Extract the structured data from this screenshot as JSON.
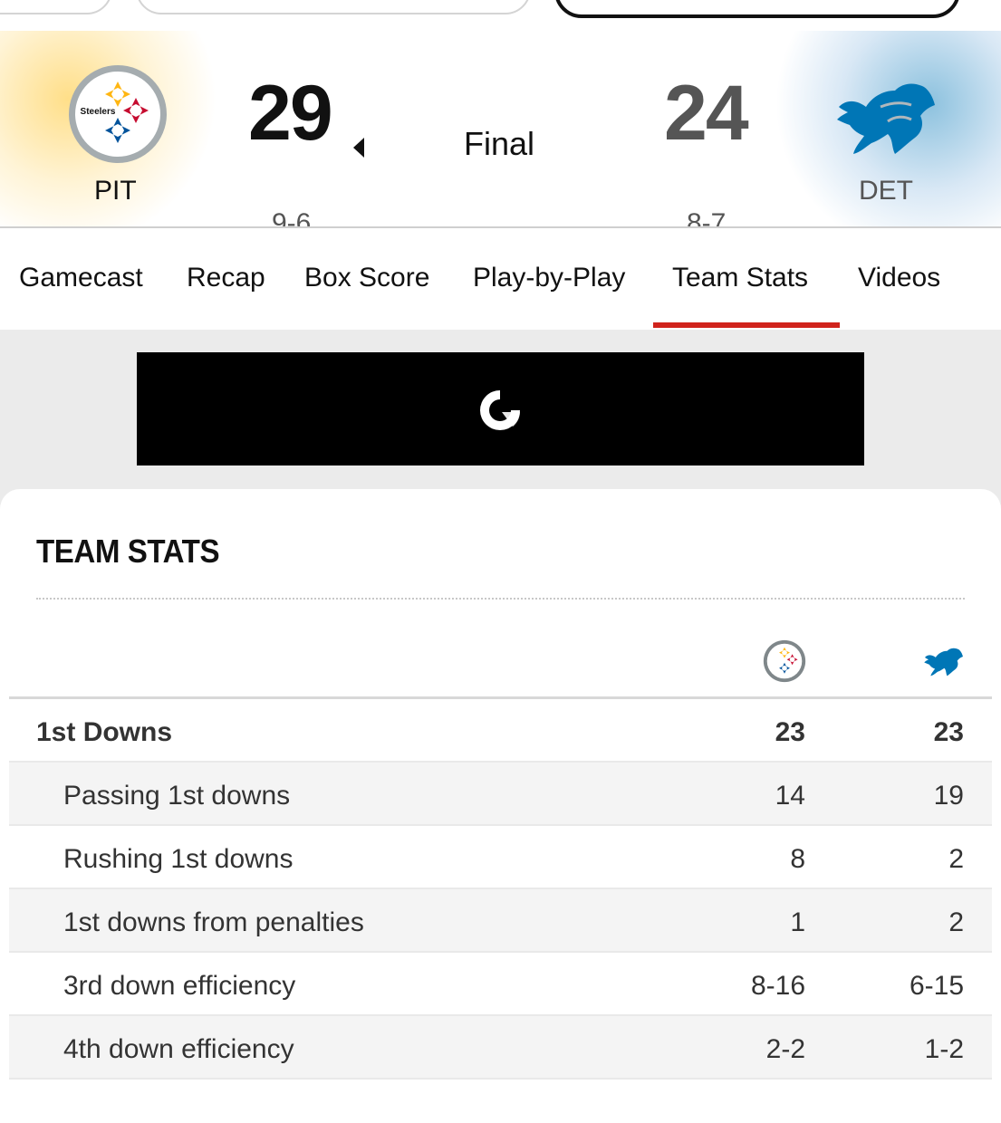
{
  "game": {
    "status": "Final",
    "home": {
      "abbr": "PIT",
      "score": "29",
      "record": "9-6",
      "color": "#FFB612"
    },
    "away": {
      "abbr": "DET",
      "score": "24",
      "record": "8-7",
      "color": "#0076B6"
    }
  },
  "tabs": [
    {
      "label": "Gamecast",
      "active": false
    },
    {
      "label": "Recap",
      "active": false
    },
    {
      "label": "Box Score",
      "active": false
    },
    {
      "label": "Play-by-Play",
      "active": false
    },
    {
      "label": "Team Stats",
      "active": true
    },
    {
      "label": "Videos",
      "active": false
    }
  ],
  "accent_color": "#D0231C",
  "team_stats": {
    "title": "TEAM STATS",
    "rows": [
      {
        "label": "1st Downs",
        "pit": "23",
        "det": "23"
      },
      {
        "label": "Passing 1st downs",
        "pit": "14",
        "det": "19"
      },
      {
        "label": "Rushing 1st downs",
        "pit": "8",
        "det": "2"
      },
      {
        "label": "1st downs from penalties",
        "pit": "1",
        "det": "2"
      },
      {
        "label": "3rd down efficiency",
        "pit": "8-16",
        "det": "6-15"
      },
      {
        "label": "4th down efficiency",
        "pit": "2-2",
        "det": "1-2"
      }
    ]
  },
  "icons": {
    "home_logo": "steelers-logo-icon",
    "away_logo": "lions-logo-icon",
    "winner_indicator": "caret-left-icon",
    "ad_loading": "loading-spinner-icon"
  }
}
